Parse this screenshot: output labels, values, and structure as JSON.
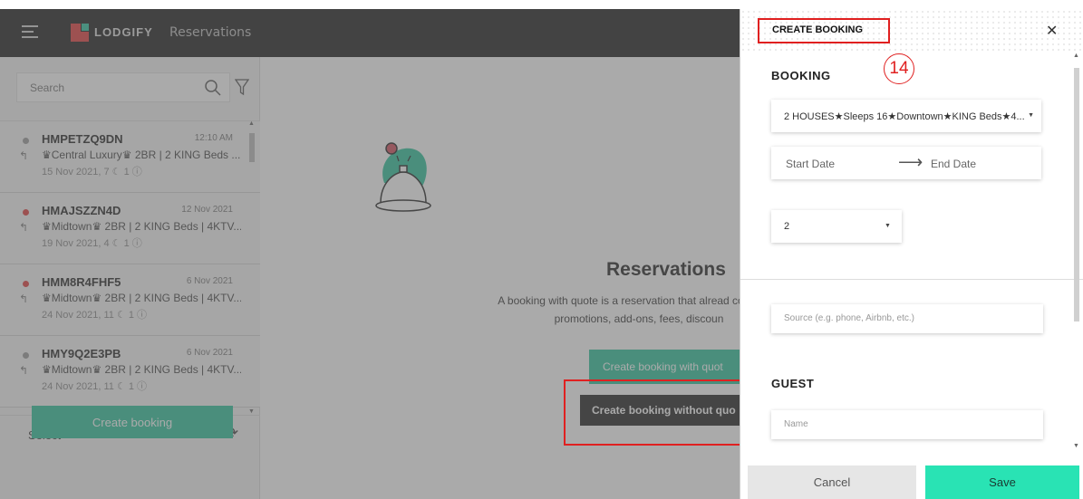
{
  "topbar": {
    "logo": "LODGIFY",
    "section": "Reservations"
  },
  "sidebar": {
    "search_placeholder": "Search",
    "reservations": [
      {
        "code": "HMPETZQ9DN",
        "time": "12:10 AM",
        "property": "♛Central Luxury♛ 2BR | 2 KING Beds ...",
        "meta": "15 Nov 2021, 7 ☾ 1 ⓘ",
        "status_color": "#9a9a9a"
      },
      {
        "code": "HMAJSZZN4D",
        "time": "12 Nov 2021",
        "property": "♛Midtown♛ 2BR | 2 KING Beds | 4KTV...",
        "meta": "19 Nov 2021, 4 ☾ 1 ⓘ",
        "status_color": "#e03b3b"
      },
      {
        "code": "HMM8R4FHF5",
        "time": "6 Nov 2021",
        "property": "♛Midtown♛ 2BR | 2 KING Beds | 4KTV...",
        "meta": "24 Nov 2021, 11 ☾ 1 ⓘ",
        "status_color": "#e03b3b"
      },
      {
        "code": "HMY9Q2E3PB",
        "time": "6 Nov 2021",
        "property": "♛Midtown♛ 2BR | 2 KING Beds | 4KTV...",
        "meta": "24 Nov 2021, 11 ☾ 1 ⓘ",
        "status_color": "#9a9a9a"
      }
    ],
    "select_label": "Select",
    "create_booking": "Create booking"
  },
  "main": {
    "title": "Reservations",
    "description": "A booking with quote is a reservation that alread costs with promotions, add-ons, fees, discoun",
    "btn_with_quote": "Create booking with quot",
    "btn_without_quote": "Create booking without quo"
  },
  "drawer": {
    "title": "CREATE BOOKING",
    "annotation": "14",
    "booking_heading": "BOOKING",
    "property": "2 HOUSES★Sleeps 16★Downtown★KING Beds★4...",
    "start_date": "Start Date",
    "end_date": "End Date",
    "guests": "2",
    "source_placeholder": "Source (e.g. phone, Airbnb, etc.)",
    "guest_heading": "GUEST",
    "name_placeholder": "Name",
    "cancel": "Cancel",
    "save": "Save"
  },
  "colors": {
    "accent": "#2bc29a",
    "save": "#29e3b4",
    "highlight": "#e02020",
    "topbar": "#1c1c1c"
  }
}
